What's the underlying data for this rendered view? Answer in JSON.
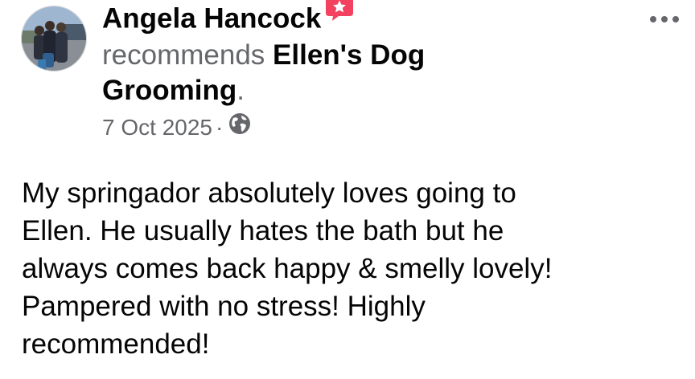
{
  "post": {
    "author": "Angela Hancock",
    "recommends_verb": "recommends",
    "page_name_line1": "Ellen's Dog",
    "page_name_line2": "Grooming",
    "period": ".",
    "date": "7 Oct 2025",
    "separator": "·",
    "audience_icon": "globe-icon",
    "badge_icon": "recommendation-star-icon",
    "more_icon": "more-options-icon",
    "body_lines": [
      "My springador absolutely loves going to",
      "Ellen. He usually hates the bath but he",
      "always comes back happy & smelly lovely!",
      "Pampered with no stress! Highly",
      "recommended!"
    ]
  },
  "colors": {
    "badge": "#f3425f",
    "secondary_text": "#65676b",
    "primary_text": "#050505"
  }
}
